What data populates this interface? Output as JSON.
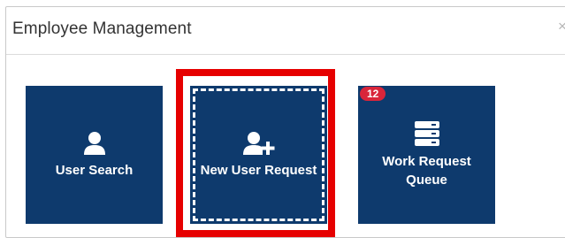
{
  "panel": {
    "title": "Employee Management",
    "close_icon": "close-icon",
    "close_glyph": "×"
  },
  "tiles": [
    {
      "label": "User Search",
      "icon": "user-icon"
    },
    {
      "label": "New User Request",
      "icon": "user-plus-icon"
    },
    {
      "label": "Work Request Queue",
      "icon": "server-stack-icon",
      "badge": "12"
    }
  ],
  "colors": {
    "tile_background": "#0e3a6d",
    "highlight_border": "#e60000",
    "badge_background": "#d9253a"
  }
}
